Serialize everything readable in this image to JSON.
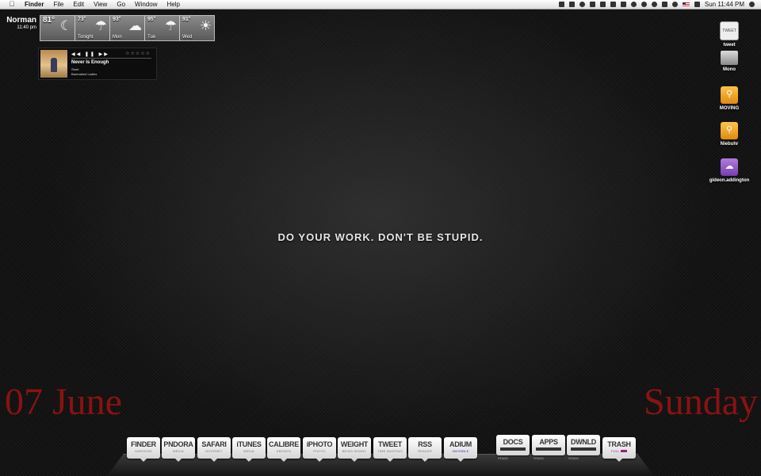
{
  "menubar": {
    "app": "Finder",
    "menus": [
      "File",
      "Edit",
      "View",
      "Go",
      "Window",
      "Help"
    ],
    "clock": "Sun 11:44 PM",
    "status_icons": [
      "app-icon",
      "app-icon",
      "gear-icon",
      "dropbox-icon",
      "app-icon",
      "app-icon",
      "app-icon",
      "evernote-icon",
      "sync-icon",
      "time-machine-icon",
      "bluetooth-icon",
      "wifi-icon",
      "us-flag-icon",
      "volume-icon",
      "spotlight-icon"
    ]
  },
  "weather": {
    "location": "Norman",
    "time": "11:40 pm",
    "cells": [
      {
        "temp": "81°",
        "day": "",
        "icon": "moon-cloud-icon",
        "glyph": "☾"
      },
      {
        "temp": "73°",
        "day": "Tonight",
        "icon": "rain-cloud-icon",
        "glyph": "☂"
      },
      {
        "temp": "93°",
        "day": "Mon",
        "icon": "sun-cloud-icon",
        "glyph": "☁"
      },
      {
        "temp": "95°",
        "day": "Tue",
        "icon": "rain-sun-icon",
        "glyph": "☂"
      },
      {
        "temp": "91°",
        "day": "Wed",
        "icon": "sun-cloud-icon",
        "glyph": "☀"
      }
    ]
  },
  "player": {
    "controls": "◀◀ ❚❚ ▶▶",
    "rating": "☆☆☆☆☆",
    "song": "Never Is Enough",
    "album": "Stunt",
    "artist": "Barenaked Ladies"
  },
  "desktop_icons": [
    {
      "label": "tweet",
      "glyph": "TWEET"
    },
    {
      "label": "Mono",
      "glyph": ""
    },
    {
      "label": "MOVING",
      "glyph": "⚲"
    },
    {
      "label": "Niebuhr",
      "glyph": "⚲"
    },
    {
      "label": "gideon.addington",
      "glyph": "☁"
    }
  ],
  "motto": "DO YOUR WORK. DON'T BE STUPID.",
  "date": {
    "left": "07 June",
    "right": "Sunday"
  },
  "dock": {
    "apps": [
      {
        "title": "FINDER",
        "sub": "HARDDISK"
      },
      {
        "title": "PNDORA",
        "sub": "MEDIA"
      },
      {
        "title": "SAFARI",
        "sub": "INTERNET"
      },
      {
        "title": "iTUNES",
        "sub": "MEDIA"
      },
      {
        "title": "CALIBRE",
        "sub": "EBOOKS"
      },
      {
        "title": "iPHOTO",
        "sub": "PHOTO"
      },
      {
        "title": "WEIGHT",
        "sub": "BEING SKINNY"
      },
      {
        "title": "TWEET",
        "sub": "TIME WASTING"
      },
      {
        "title": "RSS",
        "sub": "READER"
      },
      {
        "title": "ADIUM",
        "sub": "INVISIBLE"
      }
    ],
    "stacks": [
      {
        "title": "DOCS",
        "tag": "STACK"
      },
      {
        "title": "APPS",
        "tag": "STACK"
      },
      {
        "title": "DWNLD",
        "tag": "STACK"
      }
    ],
    "trash": {
      "title": "TRASH",
      "sub": "FULL"
    }
  }
}
